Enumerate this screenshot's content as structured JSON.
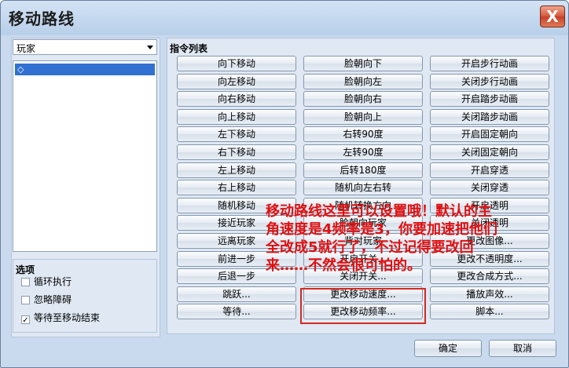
{
  "window": {
    "title": "移动路线",
    "close_glyph": "X"
  },
  "left": {
    "combo_value": "玩家",
    "list_items": [
      "◇"
    ],
    "options_title": "选项",
    "options": [
      {
        "label": "循环执行",
        "checked": false
      },
      {
        "label": "忽略障碍",
        "checked": false
      },
      {
        "label": "等待至移动结束",
        "checked": true
      }
    ]
  },
  "commands": {
    "title": "指令列表",
    "col1": [
      "向下移动",
      "向左移动",
      "向右移动",
      "向上移动",
      "左下移动",
      "右下移动",
      "左上移动",
      "右上移动",
      "随机移动",
      "接近玩家",
      "远离玩家",
      "前进一步",
      "后退一步",
      "跳跃...",
      "等待..."
    ],
    "col2": [
      "脸朝向下",
      "脸朝向左",
      "脸朝向右",
      "脸朝向上",
      "右转90度",
      "左转90度",
      "后转180度",
      "随机向左右转",
      "随机转换方向",
      "脸朝向玩家",
      "背对玩家",
      "开启开关...",
      "关闭开关...",
      "更改移动速度...",
      "更改移动频率..."
    ],
    "col3": [
      "开启步行动画",
      "关闭步行动画",
      "开启踏步动画",
      "关闭踏步动画",
      "开启固定朝向",
      "关闭固定朝向",
      "开启穿透",
      "关闭穿透",
      "开启透明",
      "关闭透明",
      "更改图像...",
      "更改不透明度...",
      "更改合成方式...",
      "播放声效...",
      "脚本..."
    ]
  },
  "annotation": "移动路线这里可以设置哦！默认的主角速度是4频率是3，你要加速把他们全改成5就行了，不过记得要改回来……不然会很可怕的。",
  "footer": {
    "ok": "确定",
    "cancel": "取消"
  },
  "colors": {
    "highlight": "#d42a1d",
    "annotation": "#e01010",
    "selection": "#3070d0"
  }
}
